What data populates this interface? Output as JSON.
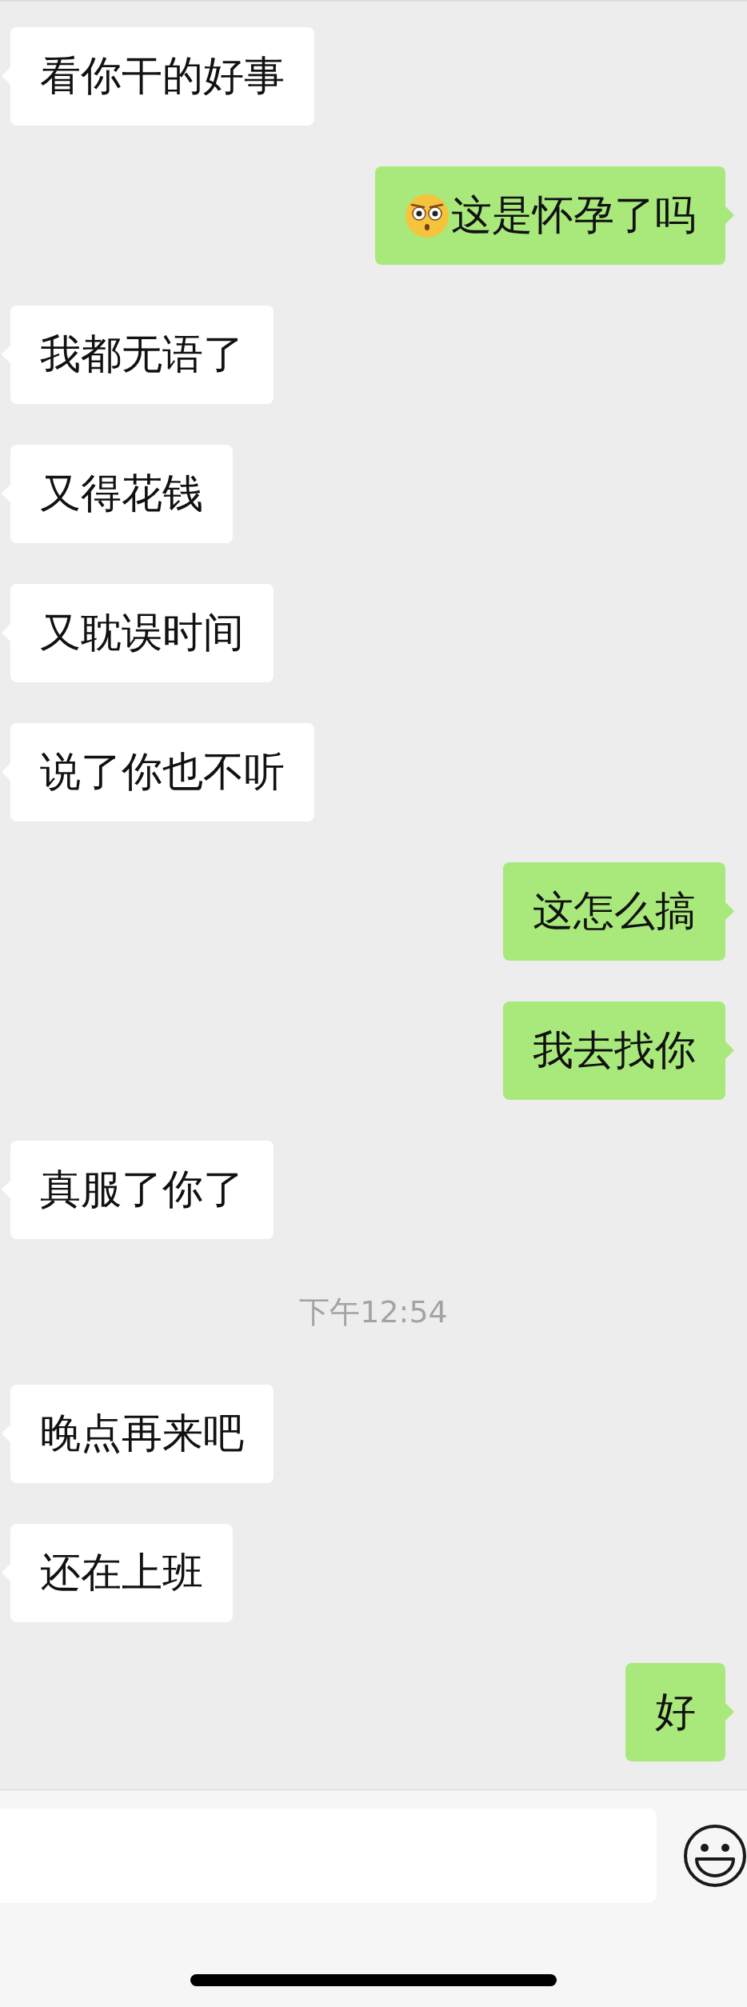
{
  "messages": [
    {
      "kind": "received",
      "text": "看你干的好事",
      "emoji": false
    },
    {
      "kind": "sent",
      "text": "这是怀孕了吗",
      "emoji": true
    },
    {
      "kind": "received",
      "text": "我都无语了",
      "emoji": false
    },
    {
      "kind": "received",
      "text": "又得花钱",
      "emoji": false
    },
    {
      "kind": "received",
      "text": "又耽误时间",
      "emoji": false
    },
    {
      "kind": "received",
      "text": "说了你也不听",
      "emoji": false
    },
    {
      "kind": "sent",
      "text": "这怎么搞",
      "emoji": false
    },
    {
      "kind": "sent",
      "text": "我去找你",
      "emoji": false
    },
    {
      "kind": "received",
      "text": "真服了你了",
      "emoji": false
    },
    {
      "kind": "timestamp",
      "text": "下午12:54"
    },
    {
      "kind": "received",
      "text": "晚点再来吧",
      "emoji": false
    },
    {
      "kind": "received",
      "text": "还在上班",
      "emoji": false
    },
    {
      "kind": "sent",
      "text": "好",
      "emoji": false
    }
  ]
}
